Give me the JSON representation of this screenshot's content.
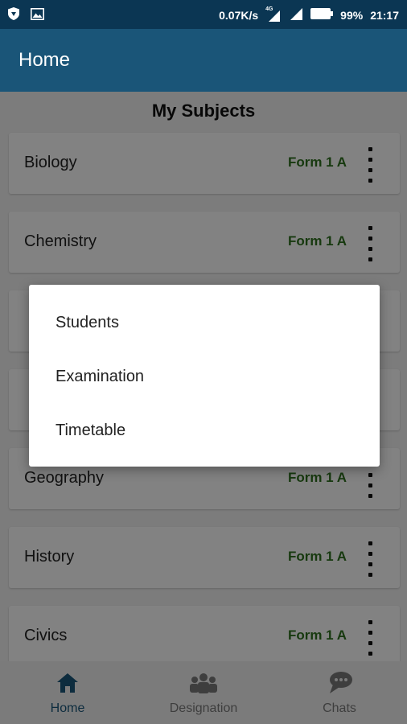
{
  "status_bar": {
    "speed": "0.07K/s",
    "network": "4G",
    "battery": "99%",
    "time": "21:17"
  },
  "app_bar": {
    "title": "Home"
  },
  "section": {
    "title": "My Subjects"
  },
  "subjects": [
    {
      "name": "Biology",
      "form": "Form 1 A"
    },
    {
      "name": "Chemistry",
      "form": "Form 1 A"
    },
    {
      "name": "",
      "form": ""
    },
    {
      "name": "",
      "form": ""
    },
    {
      "name": "Geography",
      "form": "Form 1 A"
    },
    {
      "name": "History",
      "form": "Form 1 A"
    },
    {
      "name": "Civics",
      "form": "Form 1 A"
    }
  ],
  "popup_menu": {
    "items": [
      "Students",
      "Examination",
      "Timetable"
    ]
  },
  "bottom_nav": {
    "items": [
      {
        "label": "Home",
        "icon": "home-icon",
        "active": true
      },
      {
        "label": "Designation",
        "icon": "group-icon",
        "active": false
      },
      {
        "label": "Chats",
        "icon": "chat-icon",
        "active": false
      }
    ]
  },
  "colors": {
    "status_bar": "#0b3653",
    "app_bar": "#1a5578",
    "form_text": "#2d6e1e",
    "nav_active": "#1a5578",
    "nav_inactive": "#777777"
  }
}
